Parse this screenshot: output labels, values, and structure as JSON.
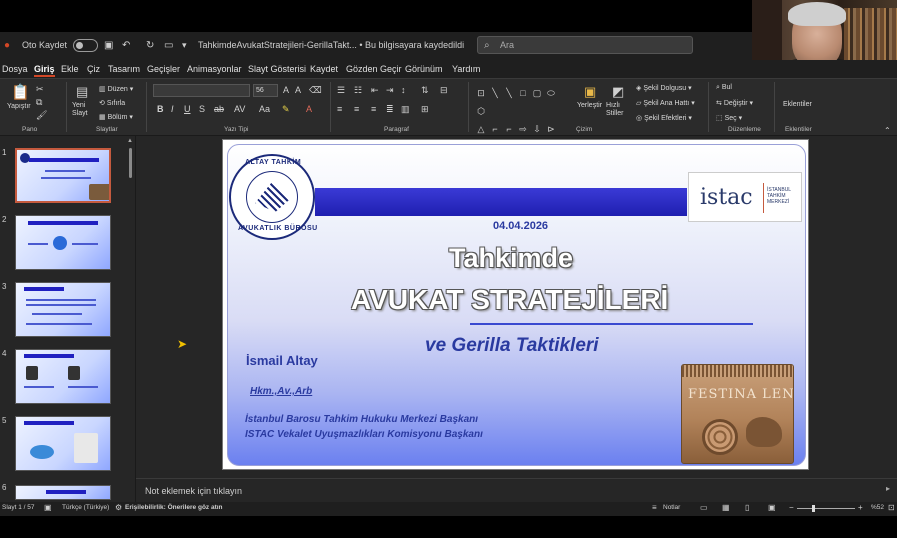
{
  "titlebar": {
    "autosave_label": "Oto Kaydet",
    "filename": "TahkimdeAvukatStratejileri-GerillaTakt... • Bu bilgisayara kaydedildi",
    "search_placeholder": "Ara"
  },
  "menu": [
    {
      "label": "Dosya"
    },
    {
      "label": "Giriş",
      "active": true
    },
    {
      "label": "Ekle"
    },
    {
      "label": "Çiz"
    },
    {
      "label": "Tasarım"
    },
    {
      "label": "Geçişler"
    },
    {
      "label": "Animasyonlar"
    },
    {
      "label": "Slayt Gösterisi"
    },
    {
      "label": "Kaydet"
    },
    {
      "label": "Gözden Geçir"
    },
    {
      "label": "Görünüm"
    },
    {
      "label": "Yardım"
    }
  ],
  "ribbon": {
    "paste": "Yapıştır",
    "new_slide": "Yeni Slayt",
    "layout": "Düzen",
    "reset": "Sıfırla",
    "section": "Bölüm",
    "font_size": "56",
    "arrange": "Yerleştir",
    "quick_styles": "Hızlı Stiller",
    "shape_fill": "Şekil Dolgusu",
    "shape_outline": "Şekil Ana Hattı",
    "shape_effects": "Şekil Efektleri",
    "find": "Bul",
    "replace": "Değiştir",
    "select": "Seç",
    "addins": "Eklentiler",
    "groups": {
      "clipboard": "Pano",
      "slides": "Slaytlar",
      "font": "Yazı Tipi",
      "paragraph": "Paragraf",
      "drawing": "Çizim",
      "editing": "Düzenleme",
      "addins": "Eklentiler"
    }
  },
  "thumbnails": [
    {
      "num": "1"
    },
    {
      "num": "2"
    },
    {
      "num": "3"
    },
    {
      "num": "4"
    },
    {
      "num": "5"
    },
    {
      "num": "6"
    }
  ],
  "slide": {
    "logo_ring_top": "ALTAY TAHKİM",
    "logo_ring_bottom": "AVUKATLIK BÜROSU",
    "istac_logo": "istac",
    "istac_sub": "İSTANBUL TAHKİM MERKEZİ",
    "date": "04.04.2026",
    "title_line1": "Tahkimde",
    "title_line2": "AVUKAT STRATEJİLERİ",
    "subtitle": "ve Gerilla Taktikleri",
    "author": "İsmail Altay",
    "credentials": "Hkm.,Av.,Arb",
    "affiliation1": "İstanbul Barosu Tahkim Hukuku Merkezi Başkanı",
    "affiliation2": "ISTAC Vekalet Uyuşmazlıkları Komisyonu Başkanı",
    "relief_text": "FESTINA LENTE"
  },
  "notes": {
    "placeholder": "Not eklemek için tıklayın"
  },
  "status": {
    "slide_counter": "Slayt 1 / 57",
    "language": "Türkçe (Türkiye)",
    "accessibility": "Erişilebilirlik: Önerilere göz atın",
    "notes_button": "Notlar",
    "zoom": "%52"
  }
}
